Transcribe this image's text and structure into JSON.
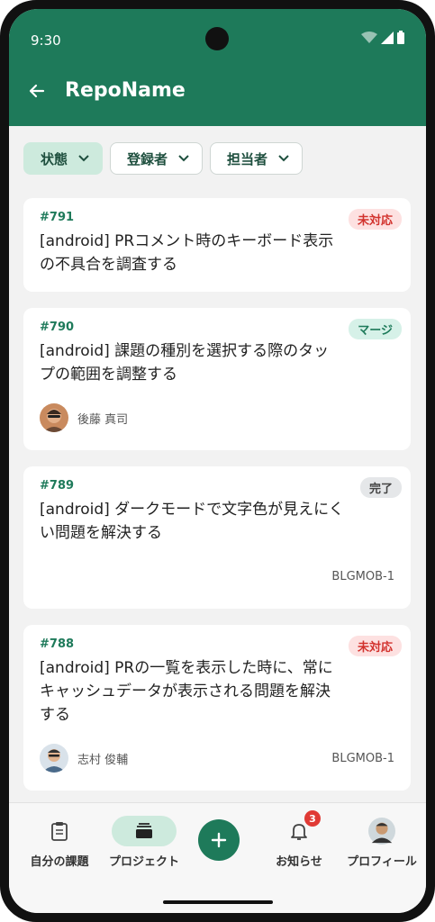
{
  "status": {
    "time": "9:30"
  },
  "header": {
    "title": "RepoName"
  },
  "filters": [
    {
      "label": "状態",
      "active": true
    },
    {
      "label": "登録者",
      "active": false
    },
    {
      "label": "担当者",
      "active": false
    }
  ],
  "issues": [
    {
      "number": "#791",
      "title": "[android] PRコメント時のキーボード表示の不具合を調査する",
      "status": "未対応",
      "assignee": "",
      "key": ""
    },
    {
      "number": "#790",
      "title": "[android] 課題の種別を選択する際のタップの範囲を調整する",
      "status": "マージ",
      "assignee": "後藤 真司",
      "key": ""
    },
    {
      "number": "#789",
      "title": "[android] ダークモードで文字色が見えにくい問題を解決する",
      "status": "完了",
      "assignee": "",
      "key": "BLGMOB-1"
    },
    {
      "number": "#788",
      "title": "[android] PRの一覧を表示した時に、常にキャッシュデータが表示される問題を解決する",
      "status": "未対応",
      "assignee": "志村 俊輔",
      "key": "BLGMOB-1"
    }
  ],
  "nav": {
    "my_issues": "自分の課題",
    "projects": "プロジェクト",
    "notifications": "お知らせ",
    "notification_count": "3",
    "profile": "プロフィール"
  },
  "colors": {
    "brand": "#1e7a5a",
    "pill": "#cdeadd",
    "badge_red": "#d2322d"
  }
}
